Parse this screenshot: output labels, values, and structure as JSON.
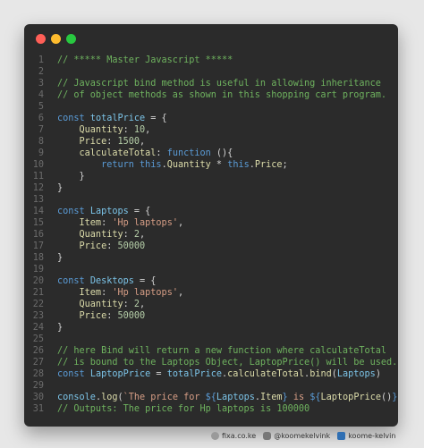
{
  "window": {
    "controls": [
      {
        "name": "close",
        "color": "#ff5f57"
      },
      {
        "name": "minimize",
        "color": "#febc2e"
      },
      {
        "name": "maximize",
        "color": "#28c840"
      }
    ]
  },
  "code": {
    "lines": [
      {
        "n": "1",
        "tokens": [
          {
            "t": "// ***** Master Javascript *****",
            "c": "comment"
          }
        ]
      },
      {
        "n": "2",
        "tokens": []
      },
      {
        "n": "3",
        "tokens": [
          {
            "t": "// Javascript bind method is useful in allowing inheritance",
            "c": "comment"
          }
        ]
      },
      {
        "n": "4",
        "tokens": [
          {
            "t": "// of object methods as shown in this shopping cart program.",
            "c": "comment"
          }
        ]
      },
      {
        "n": "5",
        "tokens": []
      },
      {
        "n": "6",
        "tokens": [
          {
            "t": "const ",
            "c": "keyword"
          },
          {
            "t": "totalPrice",
            "c": "var"
          },
          {
            "t": " = {",
            "c": "plain"
          }
        ]
      },
      {
        "n": "7",
        "tokens": [
          {
            "t": "    Quantity",
            "c": "prop"
          },
          {
            "t": ": ",
            "c": "plain"
          },
          {
            "t": "10",
            "c": "number"
          },
          {
            "t": ",",
            "c": "plain"
          }
        ]
      },
      {
        "n": "8",
        "tokens": [
          {
            "t": "    Price",
            "c": "prop"
          },
          {
            "t": ": ",
            "c": "plain"
          },
          {
            "t": "1500",
            "c": "number"
          },
          {
            "t": ",",
            "c": "plain"
          }
        ]
      },
      {
        "n": "9",
        "tokens": [
          {
            "t": "    calculateTotal",
            "c": "func"
          },
          {
            "t": ": ",
            "c": "plain"
          },
          {
            "t": "function",
            "c": "keyword"
          },
          {
            "t": " (){",
            "c": "plain"
          }
        ]
      },
      {
        "n": "10",
        "tokens": [
          {
            "t": "        return ",
            "c": "keyword"
          },
          {
            "t": "this",
            "c": "this"
          },
          {
            "t": ".",
            "c": "plain"
          },
          {
            "t": "Quantity",
            "c": "prop"
          },
          {
            "t": " * ",
            "c": "plain"
          },
          {
            "t": "this",
            "c": "this"
          },
          {
            "t": ".",
            "c": "plain"
          },
          {
            "t": "Price",
            "c": "prop"
          },
          {
            "t": ";",
            "c": "plain"
          }
        ]
      },
      {
        "n": "11",
        "tokens": [
          {
            "t": "    }",
            "c": "plain"
          }
        ]
      },
      {
        "n": "12",
        "tokens": [
          {
            "t": "}",
            "c": "plain"
          }
        ]
      },
      {
        "n": "13",
        "tokens": []
      },
      {
        "n": "14",
        "tokens": [
          {
            "t": "const ",
            "c": "keyword"
          },
          {
            "t": "Laptops",
            "c": "var"
          },
          {
            "t": " = {",
            "c": "plain"
          }
        ]
      },
      {
        "n": "15",
        "tokens": [
          {
            "t": "    Item",
            "c": "prop"
          },
          {
            "t": ": ",
            "c": "plain"
          },
          {
            "t": "'Hp laptops'",
            "c": "string"
          },
          {
            "t": ",",
            "c": "plain"
          }
        ]
      },
      {
        "n": "16",
        "tokens": [
          {
            "t": "    Quantity",
            "c": "prop"
          },
          {
            "t": ": ",
            "c": "plain"
          },
          {
            "t": "2",
            "c": "number"
          },
          {
            "t": ",",
            "c": "plain"
          }
        ]
      },
      {
        "n": "17",
        "tokens": [
          {
            "t": "    Price",
            "c": "prop"
          },
          {
            "t": ": ",
            "c": "plain"
          },
          {
            "t": "50000",
            "c": "number"
          }
        ]
      },
      {
        "n": "18",
        "tokens": [
          {
            "t": "}",
            "c": "plain"
          }
        ]
      },
      {
        "n": "19",
        "tokens": []
      },
      {
        "n": "20",
        "tokens": [
          {
            "t": "const ",
            "c": "keyword"
          },
          {
            "t": "Desktops",
            "c": "var"
          },
          {
            "t": " = {",
            "c": "plain"
          }
        ]
      },
      {
        "n": "21",
        "tokens": [
          {
            "t": "    Item",
            "c": "prop"
          },
          {
            "t": ": ",
            "c": "plain"
          },
          {
            "t": "'Hp laptops'",
            "c": "string"
          },
          {
            "t": ",",
            "c": "plain"
          }
        ]
      },
      {
        "n": "22",
        "tokens": [
          {
            "t": "    Quantity",
            "c": "prop"
          },
          {
            "t": ": ",
            "c": "plain"
          },
          {
            "t": "2",
            "c": "number"
          },
          {
            "t": ",",
            "c": "plain"
          }
        ]
      },
      {
        "n": "23",
        "tokens": [
          {
            "t": "    Price",
            "c": "prop"
          },
          {
            "t": ": ",
            "c": "plain"
          },
          {
            "t": "50000",
            "c": "number"
          }
        ]
      },
      {
        "n": "24",
        "tokens": [
          {
            "t": "}",
            "c": "plain"
          }
        ]
      },
      {
        "n": "25",
        "tokens": []
      },
      {
        "n": "26",
        "tokens": [
          {
            "t": "// here Bind will return a new function where calculateTotal",
            "c": "comment"
          }
        ]
      },
      {
        "n": "27",
        "tokens": [
          {
            "t": "// is bound to the Laptops Object, LaptopPrice() will be used.",
            "c": "comment"
          }
        ]
      },
      {
        "n": "28",
        "tokens": [
          {
            "t": "const ",
            "c": "keyword"
          },
          {
            "t": "LaptopPrice",
            "c": "var"
          },
          {
            "t": " = ",
            "c": "plain"
          },
          {
            "t": "totalPrice",
            "c": "var"
          },
          {
            "t": ".",
            "c": "plain"
          },
          {
            "t": "calculateTotal",
            "c": "prop"
          },
          {
            "t": ".",
            "c": "plain"
          },
          {
            "t": "bind",
            "c": "func"
          },
          {
            "t": "(",
            "c": "plain"
          },
          {
            "t": "Laptops",
            "c": "var"
          },
          {
            "t": ")",
            "c": "plain"
          }
        ]
      },
      {
        "n": "29",
        "tokens": []
      },
      {
        "n": "30",
        "tokens": [
          {
            "t": "console",
            "c": "var"
          },
          {
            "t": ".",
            "c": "plain"
          },
          {
            "t": "log",
            "c": "func"
          },
          {
            "t": "(",
            "c": "plain"
          },
          {
            "t": "`The price for ",
            "c": "string"
          },
          {
            "t": "${",
            "c": "keyword"
          },
          {
            "t": "Laptops",
            "c": "var"
          },
          {
            "t": ".",
            "c": "plain"
          },
          {
            "t": "Item",
            "c": "prop"
          },
          {
            "t": "}",
            "c": "keyword"
          },
          {
            "t": " is ",
            "c": "string"
          },
          {
            "t": "${",
            "c": "keyword"
          },
          {
            "t": "LaptopPrice",
            "c": "func"
          },
          {
            "t": "()",
            "c": "plain"
          },
          {
            "t": "}",
            "c": "keyword"
          },
          {
            "t": "`",
            "c": "string"
          },
          {
            "t": ")",
            "c": "plain"
          }
        ]
      },
      {
        "n": "31",
        "tokens": [
          {
            "t": "// Outputs: The price for Hp laptops is 100000",
            "c": "comment"
          }
        ]
      }
    ]
  },
  "footer": {
    "items": [
      {
        "icon": "globe-icon",
        "label": "fixa.co.ke"
      },
      {
        "icon": "instagram-icon",
        "label": "@koomekelvink"
      },
      {
        "icon": "linkedin-icon",
        "label": "koome-kelvin"
      }
    ]
  }
}
